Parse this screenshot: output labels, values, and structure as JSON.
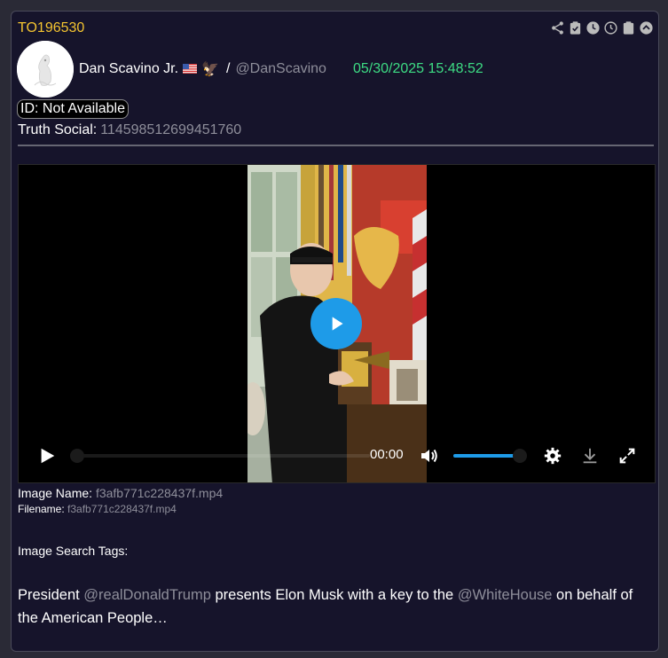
{
  "post": {
    "id": "TO196530",
    "author_name": "Dan Scavino Jr.",
    "author_emoji": "🦅",
    "slash": "/",
    "handle": "@DanScavino",
    "timestamp": "05/30/2025 15:48:52",
    "id_pill": "ID: Not Available",
    "truth_label": "Truth Social:",
    "truth_value": "114598512699451760"
  },
  "toolbar": {
    "icons": [
      "share-icon",
      "clipboard-check-icon",
      "clock-filled-icon",
      "clock-outline-icon",
      "clipboard-icon",
      "chevron-up-icon"
    ]
  },
  "video": {
    "time": "00:00",
    "progress": 0,
    "volume": 0.85,
    "accent": "#1e9be8"
  },
  "meta": {
    "image_name_label": "Image Name:",
    "image_name_value": "f3afb771c228437f.mp4",
    "filename_label": "Filename:",
    "filename_value": "f3afb771c228437f.mp4",
    "tags_label": "Image Search Tags:"
  },
  "text": {
    "part1": "President ",
    "mention1": "@realDonaldTrump",
    "part2": " presents Elon Musk with a key to the ",
    "mention2": "@WhiteHouse",
    "part3": " on behalf of the American People…"
  },
  "colors": {
    "id": "#f4c430",
    "timestamp": "#3ddc84",
    "muted": "#8e8e9a",
    "background": "#16142b"
  }
}
